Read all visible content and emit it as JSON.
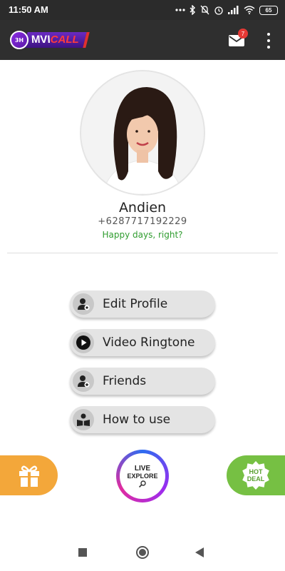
{
  "status_bar": {
    "time": "11:50 AM",
    "battery": "65",
    "icons": [
      "more-dots-icon",
      "bluetooth-icon",
      "mute-bell-icon",
      "alarm-icon",
      "signal-icon",
      "wifi-icon",
      "battery-icon"
    ]
  },
  "app_bar": {
    "logo_badge": "3H",
    "logo_text_main": "MVI",
    "logo_text_accent": "CALL",
    "mail_count": "7",
    "mail_icon": "mail-icon",
    "more_icon": "more-vert-icon"
  },
  "profile": {
    "name": "Andien",
    "phone": "+6287717192229",
    "status": "Happy days, right?"
  },
  "menu": [
    {
      "label": "Edit Profile",
      "icon": "edit-profile-icon"
    },
    {
      "label": "Video Ringtone",
      "icon": "play-icon"
    },
    {
      "label": "Friends",
      "icon": "add-friend-icon"
    },
    {
      "label": "How to use",
      "icon": "guide-book-icon"
    }
  ],
  "actions": {
    "gift_icon": "gift-icon",
    "live_line1": "LIVE",
    "live_line2": "EXPLORE",
    "hot_line1": "HOT",
    "hot_line2": "DEAL"
  },
  "colors": {
    "app_bar": "#2f2f2f",
    "status_green": "#2e9c2e",
    "gift_orange": "#f3a73a",
    "hot_green": "#76c043",
    "menu_pill": "#e4e4e4"
  }
}
